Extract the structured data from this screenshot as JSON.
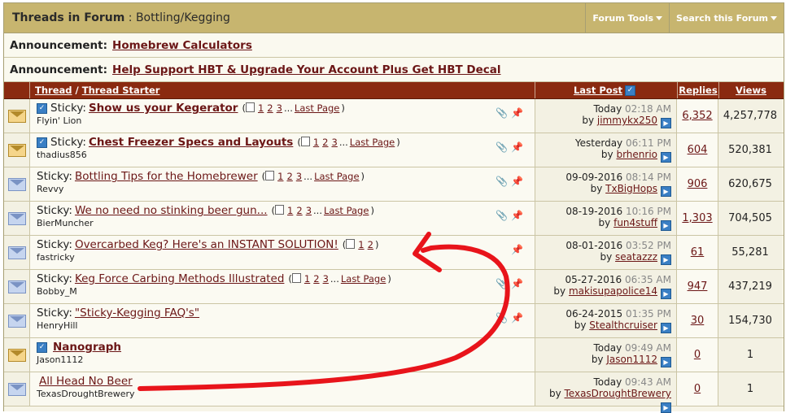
{
  "header": {
    "title": "Threads in Forum",
    "separator": ":",
    "forum": "Bottling/Kegging",
    "tools": "Forum Tools",
    "search": "Search this Forum"
  },
  "announcements": [
    {
      "label": "Announcement:",
      "link": "Homebrew Calculators"
    },
    {
      "label": "Announcement:",
      "link": "Help Support HBT & Upgrade Your Account Plus Get HBT Decal"
    }
  ],
  "columns": {
    "thread": "Thread",
    "slash": "/",
    "starter": "Thread Starter",
    "last_post": "Last Post",
    "replies": "Replies",
    "views": "Views"
  },
  "threads": [
    {
      "prefix": "Sticky:",
      "title": "Show us your Kegerator",
      "bold": true,
      "open": true,
      "check": true,
      "pages": [
        "1",
        "2",
        "3"
      ],
      "ellipsis": "...",
      "last": "Last Page",
      "starter": "Flyin' Lion",
      "date": "Today",
      "time": "02:18 AM",
      "by": "by",
      "user": "jimmykx250",
      "replies": "6,352",
      "views": "4,257,778",
      "flags": "📎📌"
    },
    {
      "prefix": "Sticky:",
      "title": "Chest Freezer Specs and Layouts",
      "bold": true,
      "open": true,
      "check": true,
      "pages": [
        "1",
        "2",
        "3"
      ],
      "ellipsis": "...",
      "last": "Last Page",
      "starter": "thadius856",
      "date": "Yesterday",
      "time": "06:11 PM",
      "by": "by",
      "user": "brhenrio",
      "replies": "604",
      "views": "520,381",
      "flags": "📎📌"
    },
    {
      "prefix": "Sticky:",
      "title": "Bottling Tips for the Homebrewer",
      "bold": false,
      "open": false,
      "check": false,
      "pages": [
        "1",
        "2",
        "3"
      ],
      "ellipsis": "...",
      "last": "Last Page",
      "starter": "Revvy",
      "date": "09-09-2016",
      "time": "08:14 PM",
      "by": "by",
      "user": "TxBigHops",
      "replies": "906",
      "views": "620,675",
      "flags": "📎📌"
    },
    {
      "prefix": "Sticky:",
      "title": "We no need no stinking beer gun...",
      "bold": false,
      "open": false,
      "check": false,
      "pages": [
        "1",
        "2",
        "3"
      ],
      "ellipsis": "...",
      "last": "Last Page",
      "starter": "BierMuncher",
      "date": "08-19-2016",
      "time": "10:16 PM",
      "by": "by",
      "user": "fun4stuff",
      "replies": "1,303",
      "views": "704,505",
      "flags": "📎📌"
    },
    {
      "prefix": "Sticky:",
      "title": "Overcarbed Keg? Here's an INSTANT SOLUTION!",
      "bold": false,
      "open": false,
      "check": false,
      "pages": [
        "1",
        "2"
      ],
      "ellipsis": "",
      "last": "",
      "starter": "fastricky",
      "date": "08-01-2016",
      "time": "03:52 PM",
      "by": "by",
      "user": "seatazzz",
      "replies": "61",
      "views": "55,281",
      "flags": "📌"
    },
    {
      "prefix": "Sticky:",
      "title": "Keg Force Carbing Methods Illustrated",
      "bold": false,
      "open": false,
      "check": false,
      "pages": [
        "1",
        "2",
        "3"
      ],
      "ellipsis": "...",
      "last": "Last Page",
      "starter": "Bobby_M",
      "date": "05-27-2016",
      "time": "06:35 AM",
      "by": "by",
      "user": "makisupapolice14",
      "replies": "947",
      "views": "437,219",
      "flags": "📎📌"
    },
    {
      "prefix": "Sticky:",
      "title": "\"Sticky-Kegging FAQ's\"",
      "bold": false,
      "open": false,
      "check": false,
      "pages": [],
      "ellipsis": "",
      "last": "",
      "starter": "HenryHill",
      "date": "06-24-2015",
      "time": "01:35 PM",
      "by": "by",
      "user": "Stealthcruiser",
      "replies": "30",
      "views": "154,730",
      "flags": "📎📌"
    },
    {
      "prefix": "",
      "title": "Nanograph",
      "bold": true,
      "open": true,
      "check": true,
      "pages": [],
      "ellipsis": "",
      "last": "",
      "starter": "Jason1112",
      "date": "Today",
      "time": "09:49 AM",
      "by": "by",
      "user": "Jason1112",
      "replies": "0",
      "views": "1",
      "flags": ""
    },
    {
      "prefix": "",
      "title": "All Head No Beer",
      "bold": false,
      "open": false,
      "check": false,
      "pages": [],
      "ellipsis": "",
      "last": "",
      "starter": "TexasDroughtBrewery",
      "date": "Today",
      "time": "09:43 AM",
      "by": "by",
      "user": "TexasDroughtBrewery",
      "replies": "0",
      "views": "1",
      "flags": ""
    }
  ],
  "colors": {
    "header": "#c7b56f",
    "columns": "#8a2a10",
    "link": "#6b1616",
    "annotation": "#e8141b"
  }
}
